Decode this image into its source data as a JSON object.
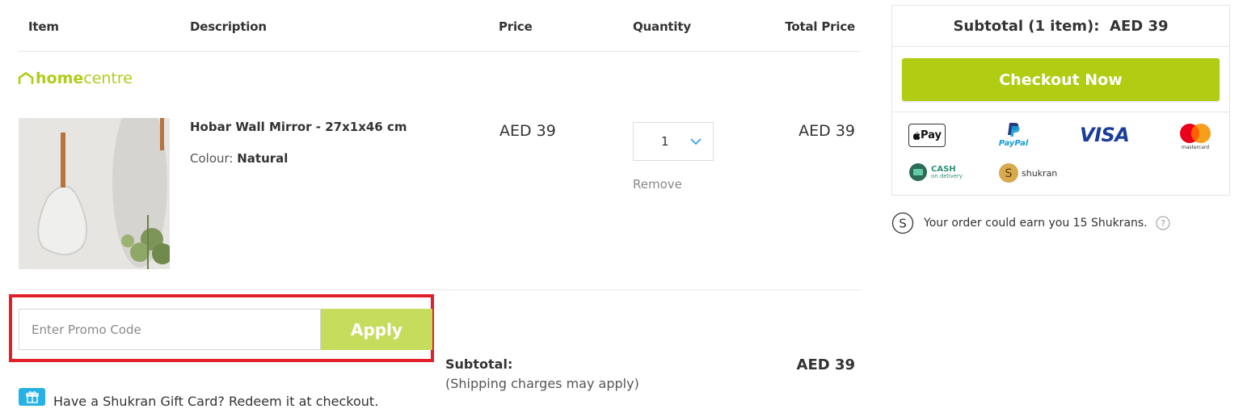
{
  "table_header": {
    "item": "Item",
    "description": "Description",
    "price": "Price",
    "quantity": "Quantity",
    "total_price": "Total Price"
  },
  "brand": {
    "bold": "home",
    "light": "centre"
  },
  "product": {
    "name": "Hobar Wall Mirror - 27x1x46 cm",
    "colour_label": "Colour:",
    "colour_value": "Natural",
    "price": "AED 39",
    "quantity": "1",
    "total": "AED 39",
    "remove_label": "Remove"
  },
  "promo": {
    "placeholder": "Enter Promo Code",
    "apply_label": "Apply"
  },
  "gift_card": {
    "text": "Have a Shukran Gift Card? Redeem it at checkout."
  },
  "subtotal": {
    "label": "Subtotal:",
    "note": "(Shipping charges may apply)",
    "value": "AED 39"
  },
  "summary": {
    "subtotal_label": "Subtotal (1 item):",
    "subtotal_value": "AED 39",
    "checkout_label": "Checkout Now",
    "payment_methods": {
      "apple_pay": "Pay",
      "paypal": "PayPal",
      "visa": "VISA",
      "mastercard": "mastercard",
      "cash_top": "CASH",
      "cash_bottom": "on delivery",
      "shukran": "shukran"
    },
    "shukran_note": "Your order could earn you 15 Shukrans."
  },
  "colors": {
    "brand_green": "#b1cc13",
    "apply_green": "#c6dc5c",
    "highlight_red": "#e2202a",
    "gift_blue": "#29b1e6"
  }
}
